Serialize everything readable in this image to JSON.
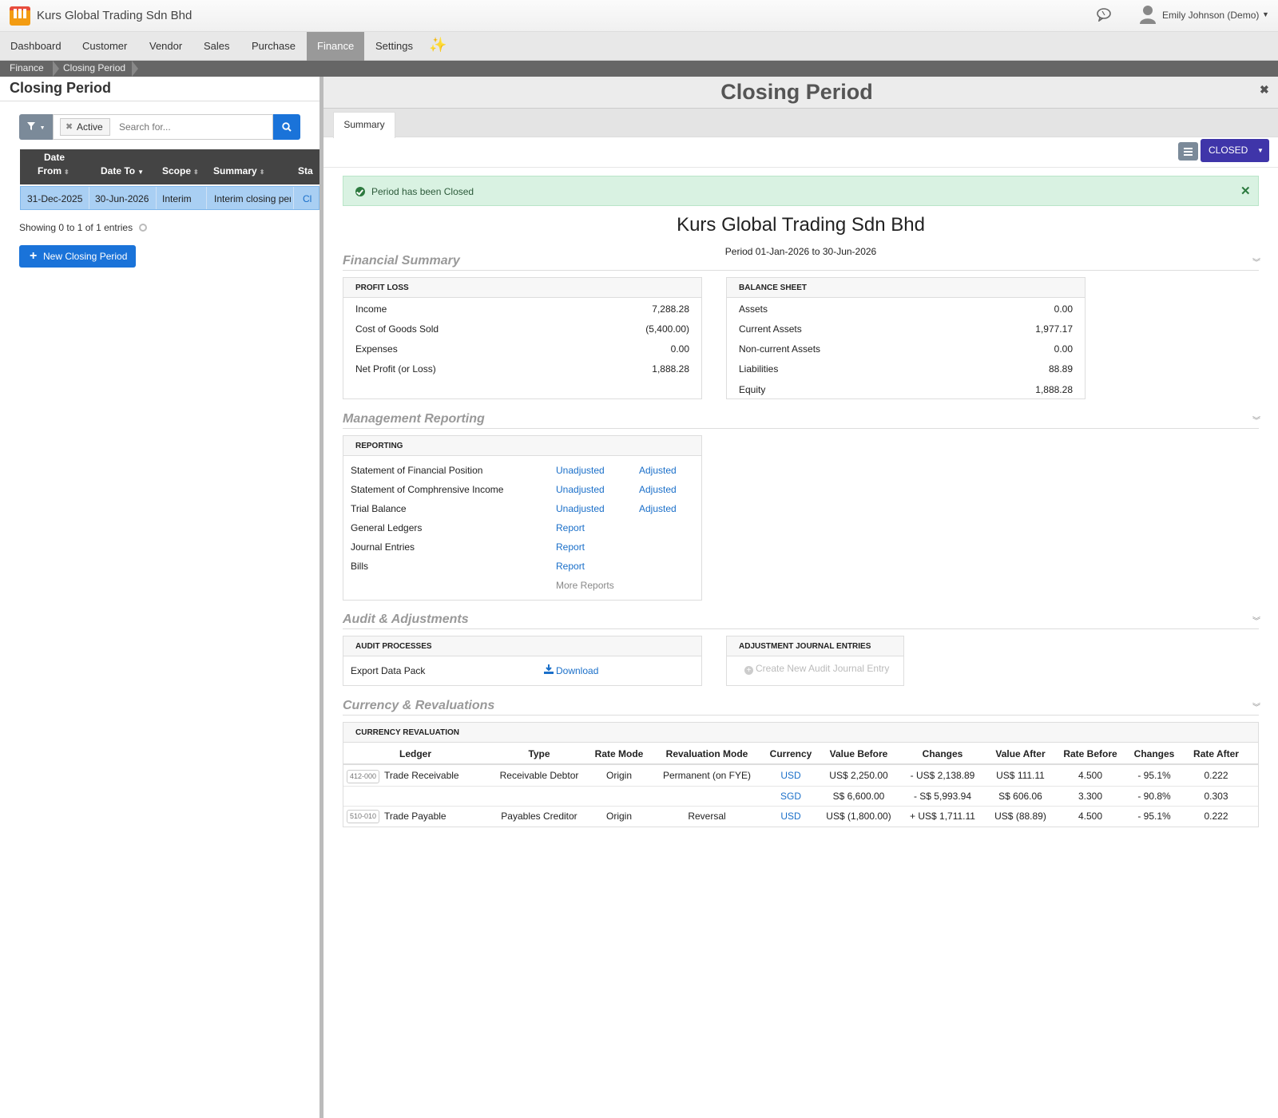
{
  "app": {
    "company": "Kurs Global Trading Sdn Bhd",
    "user": "Emily Johnson (Demo)"
  },
  "nav": {
    "items": [
      "Dashboard",
      "Customer",
      "Vendor",
      "Sales",
      "Purchase",
      "Finance",
      "Settings"
    ],
    "active": "Finance"
  },
  "breadcrumb": [
    "Finance",
    "Closing Period"
  ],
  "list": {
    "title": "Closing Period",
    "filter_chip": "Active",
    "search_placeholder": "Search for...",
    "columns": {
      "date_from_line1": "Date",
      "date_from_line2": "From",
      "date_to": "Date To",
      "scope": "Scope",
      "summary": "Summary",
      "status": "Sta"
    },
    "rows": [
      {
        "date_from": "31-Dec-2025",
        "date_to": "30-Jun-2026",
        "scope": "Interim",
        "summary": "Interim closing per",
        "status": "Cl"
      }
    ],
    "showing": "Showing 0 to 1 of 1 entries",
    "new_button": "New Closing Period"
  },
  "detail": {
    "title": "Closing Period",
    "tab": "Summary",
    "status_button": "CLOSED",
    "alert": "Period has been Closed",
    "company": "Kurs Global Trading Sdn Bhd",
    "period": "Period 01-Jan-2026 to 30-Jun-2026",
    "sections": {
      "financial": "Financial Summary",
      "management": "Management Reporting",
      "audit": "Audit & Adjustments",
      "currency": "Currency & Revaluations"
    },
    "profit_loss": {
      "title": "PROFIT LOSS",
      "rows": [
        {
          "label": "Income",
          "value": "7,288.28"
        },
        {
          "label": "Cost of Goods Sold",
          "value": "(5,400.00)"
        },
        {
          "label": "Expenses",
          "value": "0.00"
        },
        {
          "label": "Net Profit (or Loss)",
          "value": "1,888.28"
        }
      ]
    },
    "balance_sheet": {
      "title": "BALANCE SHEET",
      "rows": [
        {
          "label": "Assets",
          "value": "0.00"
        },
        {
          "label": "Current Assets",
          "value": "1,977.17"
        },
        {
          "label": "Non-current Assets",
          "value": "0.00"
        },
        {
          "label": "Liabilities",
          "value": "88.89"
        },
        {
          "label": "Equity",
          "value": "1,888.28"
        }
      ]
    },
    "reporting": {
      "title": "REPORTING",
      "rows": [
        {
          "label": "Statement of Financial Position",
          "a": "Unadjusted",
          "b": "Adjusted"
        },
        {
          "label": "Statement of Comphrensive Income",
          "a": "Unadjusted",
          "b": "Adjusted"
        },
        {
          "label": "Trial Balance",
          "a": "Unadjusted",
          "b": "Adjusted"
        },
        {
          "label": "General Ledgers",
          "a": "Report"
        },
        {
          "label": "Journal Entries",
          "a": "Report"
        },
        {
          "label": "Bills",
          "a": "Report"
        }
      ],
      "more": "More Reports"
    },
    "audit_processes": {
      "title": "AUDIT PROCESSES",
      "label": "Export Data Pack",
      "action": "Download"
    },
    "adjustment_entries": {
      "title": "ADJUSTMENT JOURNAL ENTRIES",
      "action": "Create New Audit Journal Entry"
    },
    "revaluation": {
      "title": "CURRENCY REVALUATION",
      "headers": [
        "Ledger",
        "Type",
        "Rate Mode",
        "Revaluation Mode",
        "Currency",
        "Value Before",
        "Changes",
        "Value After",
        "Rate Before",
        "Changes",
        "Rate After"
      ],
      "rows": [
        {
          "code": "412-000",
          "ledger": "Trade Receivable",
          "type": "Receivable Debtor",
          "rate_mode": "Origin",
          "reval_mode": "Permanent (on FYE)",
          "currency": "USD",
          "value_before": "US$ 2,250.00",
          "changes": "- US$ 2,138.89",
          "value_after": "US$ 111.11",
          "rate_before": "4.500",
          "rate_changes": "- 95.1%",
          "rate_after": "0.222"
        },
        {
          "code": "",
          "ledger": "",
          "type": "",
          "rate_mode": "",
          "reval_mode": "",
          "currency": "SGD",
          "value_before": "S$ 6,600.00",
          "changes": "- S$ 5,993.94",
          "value_after": "S$ 606.06",
          "rate_before": "3.300",
          "rate_changes": "- 90.8%",
          "rate_after": "0.303"
        },
        {
          "code": "510-010",
          "ledger": "Trade Payable",
          "type": "Payables Creditor",
          "rate_mode": "Origin",
          "reval_mode": "Reversal",
          "currency": "USD",
          "value_before": "US$ (1,800.00)",
          "changes": "+ US$ 1,711.11",
          "value_after": "US$ (88.89)",
          "rate_before": "4.500",
          "rate_changes": "- 95.1%",
          "rate_after": "0.222"
        }
      ]
    }
  },
  "colors": {
    "accent": "#1a73d9",
    "status_closed": "#3f35a9",
    "alert_bg": "#d9f2e2",
    "selected_row": "#a9cff3"
  }
}
